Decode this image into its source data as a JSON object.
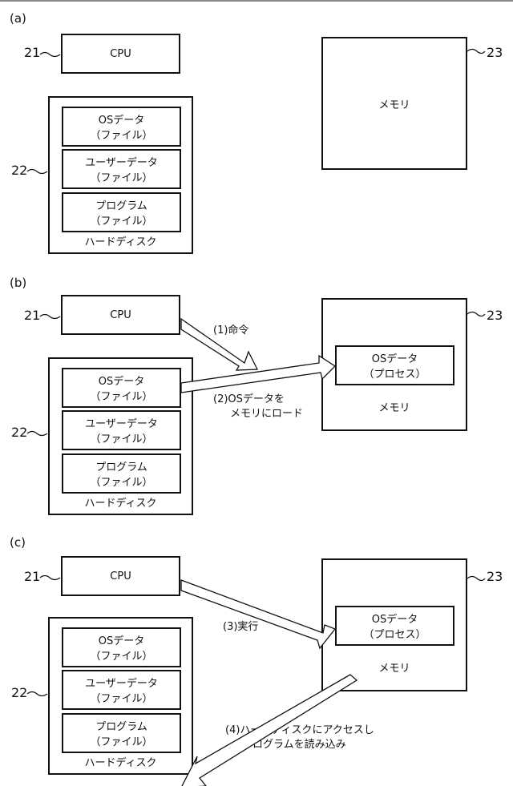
{
  "panels": [
    {
      "label": "(a)",
      "cpu": {
        "ref": "21",
        "label": "CPU"
      },
      "hdd": {
        "ref": "22",
        "label": "ハードディスク",
        "files": [
          {
            "name": "OSデータ",
            "kind": "（ファイル）"
          },
          {
            "name": "ユーザーデータ",
            "kind": "（ファイル）"
          },
          {
            "name": "プログラム",
            "kind": "（ファイル）"
          }
        ]
      },
      "memory": {
        "ref": "23",
        "label": "メモリ"
      }
    },
    {
      "label": "(b)",
      "cpu": {
        "ref": "21",
        "label": "CPU"
      },
      "hdd": {
        "ref": "22",
        "label": "ハードディスク",
        "files": [
          {
            "name": "OSデータ",
            "kind": "（ファイル）"
          },
          {
            "name": "ユーザーデータ",
            "kind": "（ファイル）"
          },
          {
            "name": "プログラム",
            "kind": "（ファイル）"
          }
        ]
      },
      "memory": {
        "ref": "23",
        "label": "メモリ",
        "process": {
          "name": "OSデータ",
          "kind": "（プロセス）"
        }
      },
      "arrows": [
        {
          "label": "(1)命令"
        },
        {
          "label_line1": "(2)OSデータを",
          "label_line2": "メモリにロード"
        }
      ]
    },
    {
      "label": "(c)",
      "cpu": {
        "ref": "21",
        "label": "CPU"
      },
      "hdd": {
        "ref": "22",
        "label": "ハードディスク",
        "files": [
          {
            "name": "OSデータ",
            "kind": "（ファイル）"
          },
          {
            "name": "ユーザーデータ",
            "kind": "（ファイル）"
          },
          {
            "name": "プログラム",
            "kind": "（ファイル）"
          }
        ]
      },
      "memory": {
        "ref": "23",
        "label": "メモリ",
        "process": {
          "name": "OSデータ",
          "kind": "（プロセス）"
        }
      },
      "arrows": [
        {
          "label": "(3)実行"
        },
        {
          "label_line1": "(4)ハードディスクにアクセスし",
          "label_line2": "プログラムを読み込み"
        }
      ]
    }
  ]
}
